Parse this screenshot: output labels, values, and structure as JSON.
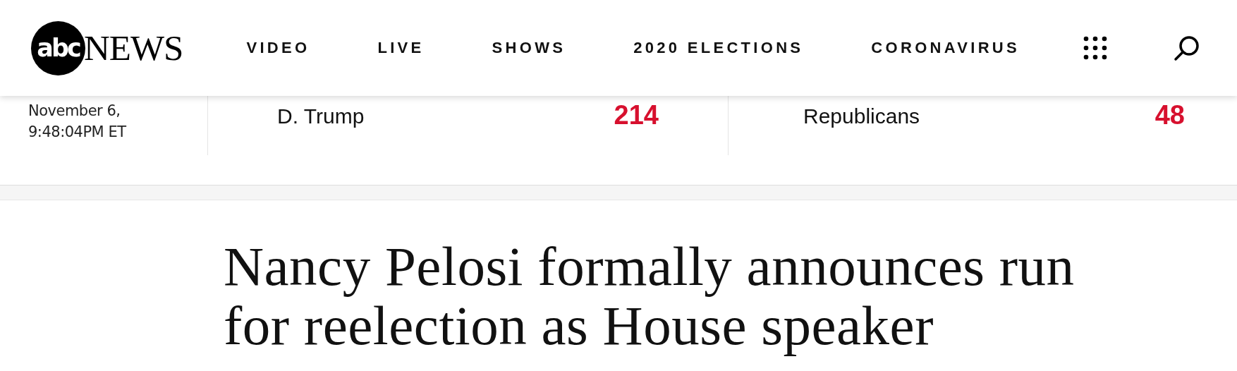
{
  "header": {
    "logo_mark": "abc",
    "logo_text": "NEWS",
    "nav": [
      {
        "label": "VIDEO"
      },
      {
        "label": "LIVE"
      },
      {
        "label": "SHOWS"
      },
      {
        "label": "2020 ELECTIONS"
      },
      {
        "label": "CORONAVIRUS"
      }
    ]
  },
  "results": {
    "timestamp": "November 6, 9:48:04PM ET",
    "entries": [
      {
        "name": "D. Trump",
        "count": "214"
      },
      {
        "name": "Republicans",
        "count": "48"
      }
    ]
  },
  "headline": "Nancy Pelosi formally announces run for reelection as House speaker"
}
